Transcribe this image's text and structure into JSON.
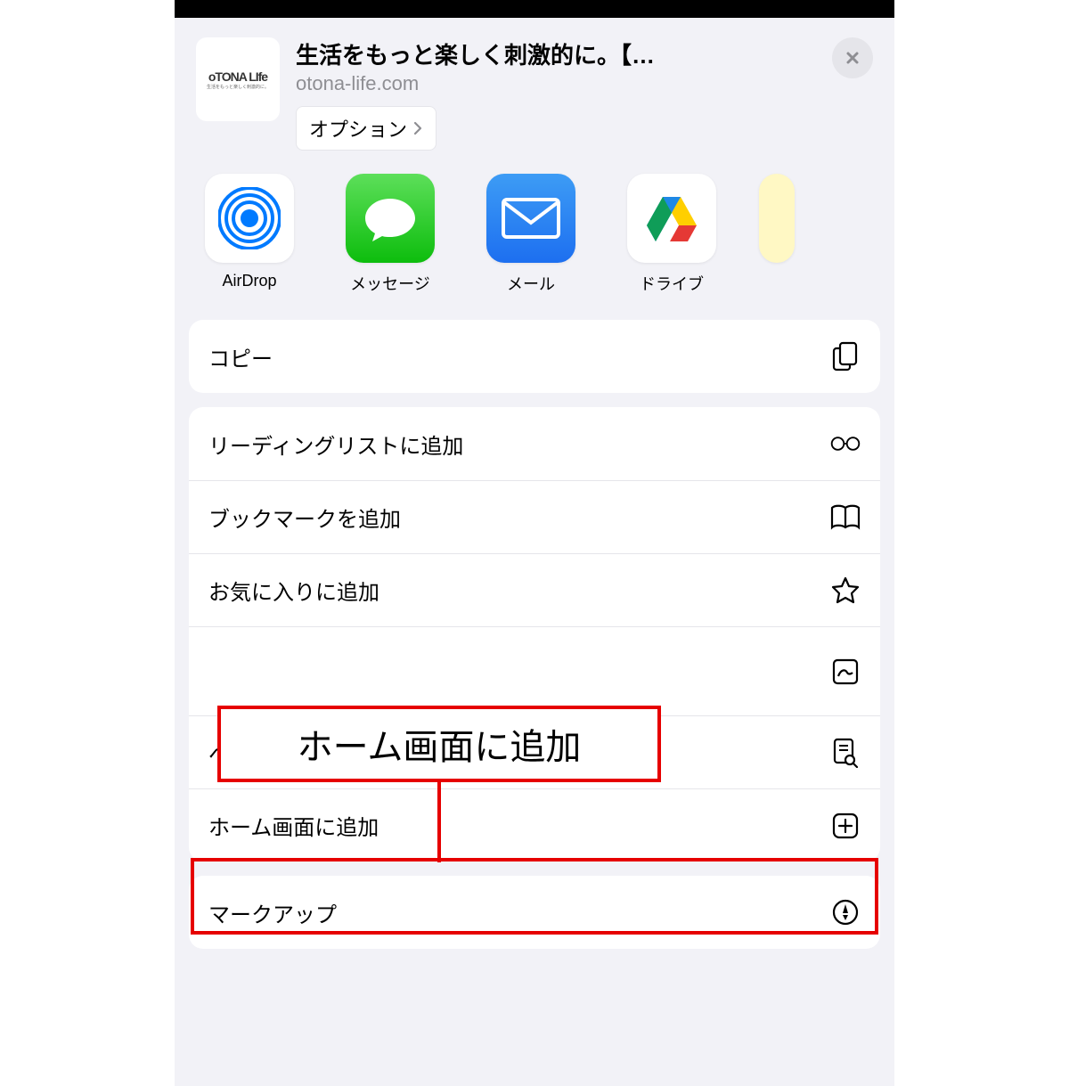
{
  "header": {
    "site_logo_text": "oTONA LIfe",
    "site_logo_tagline": "生活をもっと楽しく刺激的に。",
    "title": "生活をもっと楽しく刺激的に。【…",
    "domain": "otona-life.com",
    "options_label": "オプション"
  },
  "share_targets": [
    {
      "id": "airdrop",
      "label": "AirDrop"
    },
    {
      "id": "messages",
      "label": "メッセージ"
    },
    {
      "id": "mail",
      "label": "メール"
    },
    {
      "id": "drive",
      "label": "ドライブ"
    },
    {
      "id": "notes",
      "label": ""
    }
  ],
  "actions_copy": {
    "label": "コピー"
  },
  "actions_list": [
    {
      "id": "reading-list",
      "label": "リーディングリストに追加",
      "icon": "glasses"
    },
    {
      "id": "add-bookmark",
      "label": "ブックマークを追加",
      "icon": "book"
    },
    {
      "id": "add-favorite",
      "label": "お気に入りに追加",
      "icon": "star"
    },
    {
      "id": "find-on-page",
      "label": "ページを検索",
      "icon": "doc-search"
    },
    {
      "id": "add-to-home",
      "label": "ホーム画面に追加",
      "icon": "plus-square"
    }
  ],
  "actions_extra": [
    {
      "id": "markup",
      "label": "マークアップ",
      "icon": "pen"
    }
  ],
  "annotation": {
    "callout_text": "ホーム画面に追加"
  }
}
